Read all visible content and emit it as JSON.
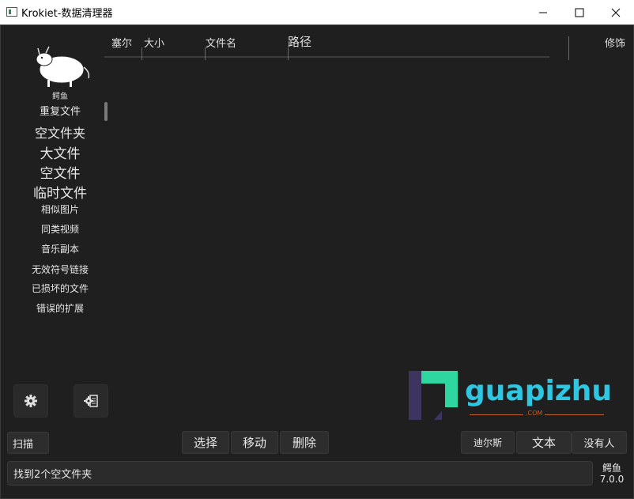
{
  "window": {
    "title": "Krokiet-数据清理器"
  },
  "logo": {
    "label": "鳄鱼"
  },
  "sidebar": {
    "items": [
      {
        "label": "重复文件"
      },
      {
        "label": "空文件夹"
      },
      {
        "label": "大文件"
      },
      {
        "label": "空文件"
      },
      {
        "label": "临时文件"
      },
      {
        "label": "相似图片"
      },
      {
        "label": "同类视频"
      },
      {
        "label": "音乐副本"
      },
      {
        "label": "无效符号链接"
      },
      {
        "label": "已损坏的文件"
      },
      {
        "label": "错误的扩展"
      }
    ]
  },
  "table": {
    "columns": [
      "塞尔",
      "大小",
      "文件名",
      "路径"
    ],
    "right_label": "修饰"
  },
  "buttons": {
    "scan": "扫描",
    "select": "选择",
    "move": "移动",
    "delete": "删除",
    "dirs": "迪尔斯",
    "text": "文本",
    "nobody": "没有人"
  },
  "status": {
    "message": "找到2个空文件夹"
  },
  "version": {
    "name": "鳄鱼",
    "number": "7.0.0"
  },
  "watermark": {
    "brand": "guapizhu",
    "suffix": ".COM"
  },
  "icons": {
    "settings": "gear-icon",
    "advanced": "gear-doc-icon"
  },
  "colors": {
    "background": "#1f1f1f",
    "accent": "#2ed6d0"
  }
}
